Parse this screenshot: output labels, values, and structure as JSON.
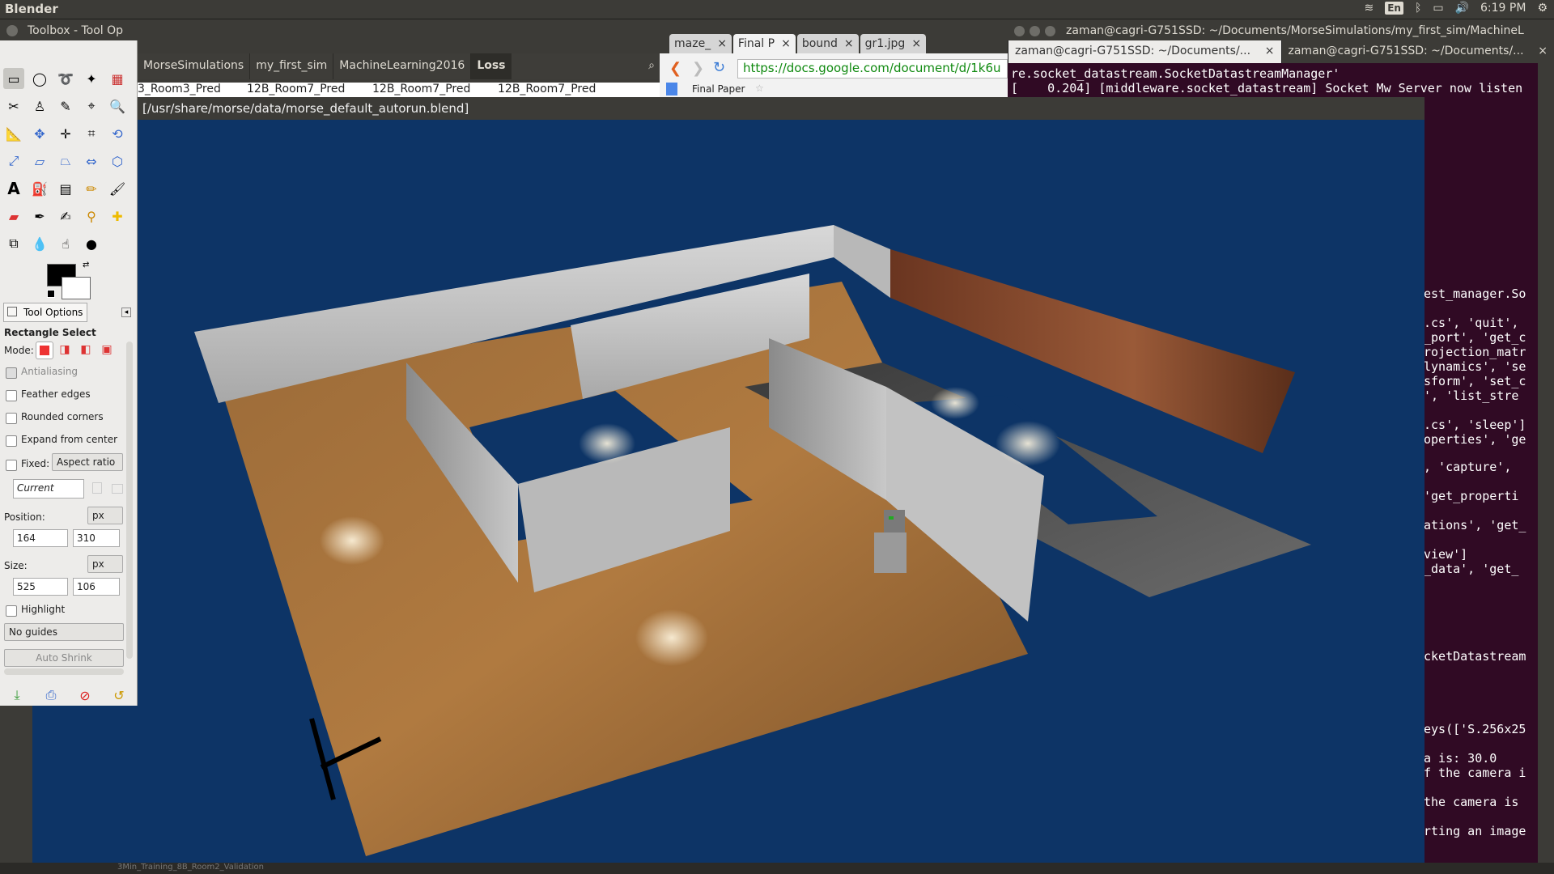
{
  "top_panel": {
    "app_name": "Blender",
    "keyboard": "En",
    "clock": "6:19 PM"
  },
  "gimp": {
    "window_title": "Toolbox - Tool Op",
    "tool_options_tab": "Tool Options",
    "tool_name": "Rectangle Select",
    "mode_label": "Mode:",
    "antialiasing_label": "Antialiasing",
    "feather_edges_label": "Feather edges",
    "rounded_corners_label": "Rounded corners",
    "expand_from_center_label": "Expand from center",
    "fixed_label": "Fixed:",
    "fixed_value": "Aspect ratio",
    "current_value": "Current",
    "position_label": "Position:",
    "position_unit": "px",
    "position_x": "164",
    "position_y": "310",
    "size_label": "Size:",
    "size_unit": "px",
    "size_w": "525",
    "size_h": "106",
    "highlight_label": "Highlight",
    "guides_value": "No guides",
    "auto_shrink_label": "Auto Shrink"
  },
  "bookmarks": {
    "items": [
      "MorseSimulations",
      "my_first_sim",
      "MachineLearning2016",
      "Loss"
    ]
  },
  "files_row": {
    "items": [
      "3_Room3_Pred",
      "12B_Room7_Pred",
      "12B_Room7_Pred",
      "12B_Room7_Pred"
    ]
  },
  "chrome": {
    "tabs": [
      "maze_",
      "Final P",
      "bound",
      "gr1.jpg"
    ],
    "url": "https://docs.google.com/document/d/1k6u",
    "doc_title": "Final Paper"
  },
  "terminal": {
    "window_title": "zaman@cagri-G751SSD: ~/Documents/MorseSimulations/my_first_sim/MachineL",
    "tab1": "zaman@cagri-G751SSD: ~/Documents/...",
    "tab2": "zaman@cagri-G751SSD: ~/Documents/...",
    "line1": "re.socket_datastream.SocketDatastreamManager'",
    "line2": "[    0.204] [middleware.socket_datastream] Socket Mw Server now listen",
    "r1": "est_manager.So",
    "r2": ".cs', 'quit',",
    "r3": "_port', 'get_c",
    "r4": "rojection_matr",
    "r5": "lynamics', 'se",
    "r6": "sform', 'set_c",
    "r7": "', 'list_stre",
    "r8": ".cs', 'sleep']",
    "r9": "operties', 'ge",
    "r10": ", 'capture',",
    "r11": "'get_properti",
    "r12": "ations', 'get_",
    "r13": "view']",
    "r14": "_data', 'get_",
    "r15": "cketDatastream",
    "r16": "eys(['S.256x25",
    "r17": "a is: 30.0",
    "r18": "f the camera i",
    "r19": "the camera is",
    "r20": "rting an image"
  },
  "blender": {
    "window_title": "[/usr/share/morse/data/morse_default_autorun.blend]"
  },
  "bottom_strip": {
    "text": "3Min_Training_8B_Room2_Validation"
  }
}
